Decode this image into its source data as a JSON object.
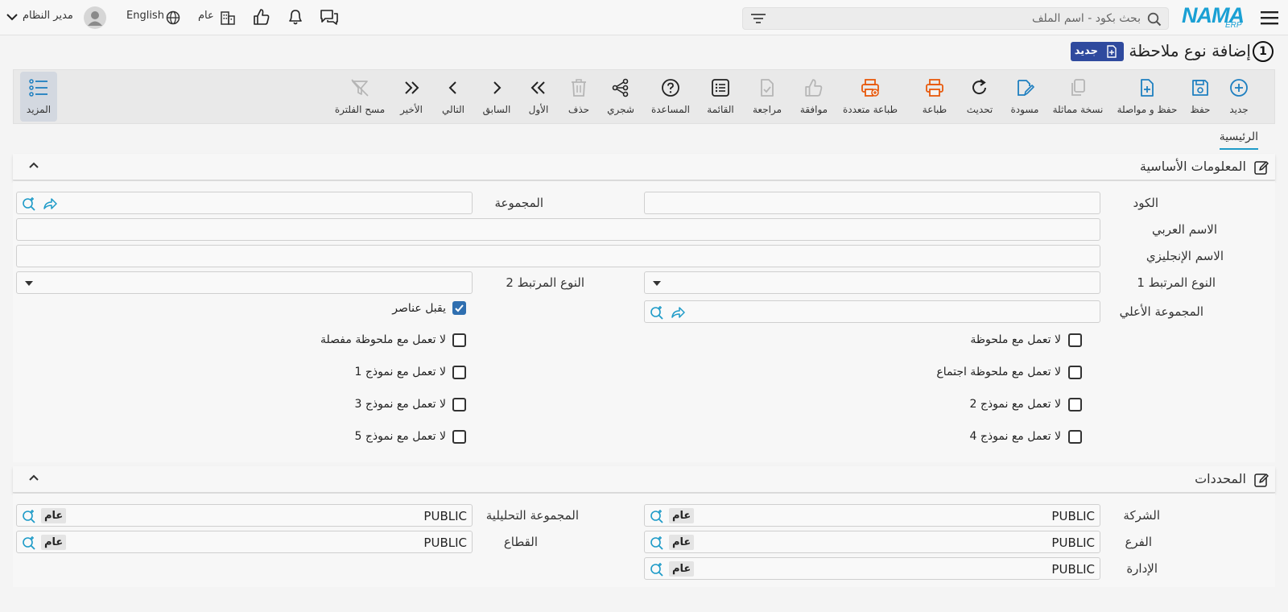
{
  "header": {
    "logo_text": "NAMA",
    "logo_sub": "ERP",
    "search_placeholder": "بحث بكود - اسم الملف",
    "language": "English",
    "scope": "عام",
    "user": "مدير النظام"
  },
  "page": {
    "title": "إضافة نوع ملاحظة",
    "step": "1",
    "badge": "جديد"
  },
  "toolbar": {
    "buttons": [
      {
        "label": "جديد",
        "icon": "plus-circle-icon"
      },
      {
        "label": "حفظ",
        "icon": "save-icon"
      },
      {
        "label": "حفظ و مواصلة",
        "icon": "file-plus-icon"
      },
      {
        "label": "نسخة مماثلة",
        "icon": "copy-icon"
      },
      {
        "label": "مسودة",
        "icon": "draft-icon"
      },
      {
        "label": "تحديث",
        "icon": "refresh-icon"
      },
      {
        "label": "طباعة",
        "icon": "print-icon"
      },
      {
        "label": "طباعة متعددة",
        "icon": "multi-print-icon"
      },
      {
        "label": "موافقة",
        "icon": "thumbs-up-icon"
      },
      {
        "label": "مراجعة",
        "icon": "review-icon"
      },
      {
        "label": "القائمة",
        "icon": "list-icon"
      },
      {
        "label": "المساعدة",
        "icon": "help-icon"
      },
      {
        "label": "شجري",
        "icon": "tree-icon"
      },
      {
        "label": "حذف",
        "icon": "trash-icon"
      },
      {
        "label": "الأول",
        "icon": "first-icon"
      },
      {
        "label": "السابق",
        "icon": "previous-icon"
      },
      {
        "label": "التالي",
        "icon": "next-icon"
      },
      {
        "label": "الأخير",
        "icon": "last-icon"
      },
      {
        "label": "مسح الفلترة",
        "icon": "clear-filter-icon"
      }
    ],
    "more": "المزيد"
  },
  "tabs": {
    "main": "الرئيسية"
  },
  "sections": {
    "basic": "المعلومات الأساسية",
    "dimensions": "المحددات"
  },
  "basic": {
    "code_label": "الكود",
    "group_label": "المجموعة",
    "arabic_name_label": "الاسم العربي",
    "english_name_label": "الاسم الإنجليزي",
    "related_type1_label": "النوع المرتبط 1",
    "related_type2_label": "النوع المرتبط 2",
    "parent_group_label": "المجموعة الأعلي",
    "accepts_elements_label": "يقبل عناصر",
    "accepts_elements_checked": true
  },
  "checkboxes": {
    "right": [
      "لا تعمل مع ملحوظة",
      "لا تعمل مع ملحوظة اجتماع",
      "لا تعمل مع نموذج 2",
      "لا تعمل مع نموذج 4"
    ],
    "left": [
      "لا تعمل مع ملحوظة مفصلة",
      "لا تعمل مع نموذج 1",
      "لا تعمل مع نموذج 3",
      "لا تعمل مع نموذج 5"
    ]
  },
  "dimensions": {
    "company_label": "الشركة",
    "branch_label": "الفرع",
    "department_label": "الإدارة",
    "analytic_group_label": "المجموعة التحليلية",
    "sector_label": "القطاع",
    "company_value": "PUBLIC",
    "branch_value": "PUBLIC",
    "department_value": "PUBLIC",
    "analytic_group_value": "PUBLIC",
    "sector_value": "PUBLIC",
    "tag": "عام"
  },
  "colors": {
    "accent": "#1e9bc8",
    "badge": "#2f4a9e",
    "print": "#e8590c",
    "checkbox": "#2f6fb0"
  }
}
